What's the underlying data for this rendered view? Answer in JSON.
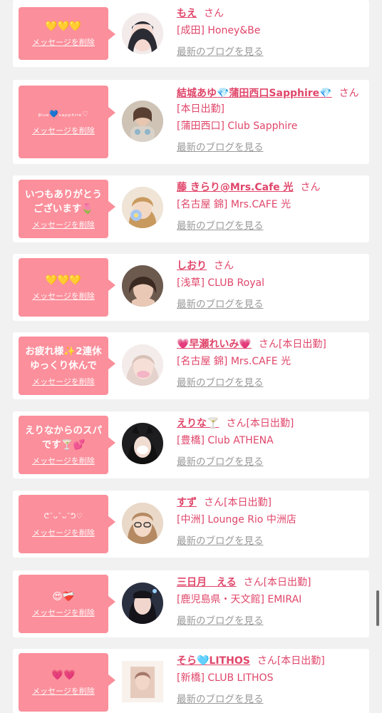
{
  "delete_label": "メッセージを削除",
  "blog_label": "最新のブログを見る",
  "san_label": "さん",
  "colors": {
    "bubble": "#fb8f9b",
    "accent": "#e0466a",
    "muted": "#9a9a9a",
    "background": "#f1f1f1"
  },
  "cards": [
    {
      "message": "💛💛💛",
      "name": "もえ",
      "status": "",
      "shop": "[成田] Honey&Be"
    },
    {
      "message": "ᵦₗᵤₑ💙ₛₐₚₚₕᵢᵣₑ♡",
      "name": "結城あゆ💎蒲田西口Sapphire💎",
      "status": "[本日出勤]",
      "shop": "[蒲田西口] Club Sapphire"
    },
    {
      "message": "いつもありがとうございます🌷",
      "name": "藤 きらり@Mrs.Cafe 光",
      "status": "",
      "shop": "[名古屋 錦] Mrs.CAFE 光"
    },
    {
      "message": "💛💛💛",
      "name": "しおり",
      "status": "",
      "shop": "[浅草] CLUB Royal"
    },
    {
      "message": "お疲れ様✨2連休ゆっくり休んで",
      "name": "💗早瀬れいみ💗",
      "status": "[本日出勤]",
      "shop": "[名古屋 錦] Mrs.CAFE 光"
    },
    {
      "message": "えりなからのスパです🍸💕",
      "name": "えりな🍸",
      "status": "[本日出勤]",
      "shop": "[豊橋] Club ATHENA"
    },
    {
      "message": "ᕦ˘ᴗ˘ᴗ˘ᕤ♡",
      "name": "すず",
      "status": "[本日出勤]",
      "shop": "[中洲] Lounge Rio 中洲店"
    },
    {
      "message": "😍❤️‍🩹",
      "name": "三日月　える",
      "status": "[本日出勤]",
      "shop": "[鹿児島県・天文館] EMIRAI"
    },
    {
      "message": "💗💗",
      "name": "そら🩵LITHOS",
      "status": "[本日出勤]",
      "shop": "[新橋] CLUB LITHOS"
    }
  ]
}
